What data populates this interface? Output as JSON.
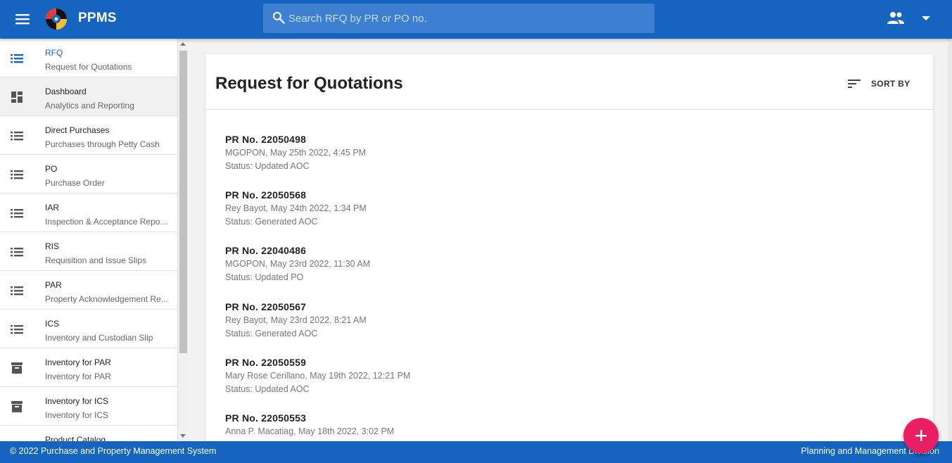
{
  "app": {
    "title": "PPMS"
  },
  "search": {
    "placeholder": "Search RFQ by PR or PO no."
  },
  "sidebar": {
    "items": [
      {
        "title": "RFQ",
        "subtitle": "Request for Quotations",
        "icon": "list-icon"
      },
      {
        "title": "Dashboard",
        "subtitle": "Analytics and Reporting",
        "icon": "dashboard-icon"
      },
      {
        "title": "Direct Purchases",
        "subtitle": "Purchases through Petty Cash",
        "icon": "list-icon"
      },
      {
        "title": "PO",
        "subtitle": "Purchase Order",
        "icon": "list-icon"
      },
      {
        "title": "IAR",
        "subtitle": "Inspection & Acceptance Repor...",
        "icon": "list-icon"
      },
      {
        "title": "RIS",
        "subtitle": "Requisition and Issue Slips",
        "icon": "list-icon"
      },
      {
        "title": "PAR",
        "subtitle": "Property Acknowledgement Re...",
        "icon": "list-icon"
      },
      {
        "title": "ICS",
        "subtitle": "Inventory and Custodian Slip",
        "icon": "list-icon"
      },
      {
        "title": "Inventory for PAR",
        "subtitle": "Inventory for PAR",
        "icon": "archive-icon"
      },
      {
        "title": "Inventory for ICS",
        "subtitle": "Inventory for ICS",
        "icon": "archive-icon"
      },
      {
        "title": "Product Catalog",
        "subtitle": "",
        "icon": "list-icon"
      }
    ]
  },
  "main": {
    "title": "Request for Quotations",
    "sort_label": "SORT BY",
    "rfqs": [
      {
        "pr": "PR No. 22050498",
        "meta": "MGOPON, May 25th 2022, 4:45 PM",
        "status": "Status: Updated AOC"
      },
      {
        "pr": "PR No. 22050568",
        "meta": "Rey Bayot, May 24th 2022, 1:34 PM",
        "status": "Status: Generated AOC"
      },
      {
        "pr": "PR No. 22040486",
        "meta": "MGOPON, May 23rd 2022, 11:30 AM",
        "status": "Status: Updated PO"
      },
      {
        "pr": "PR No. 22050567",
        "meta": "Rey Bayot, May 23rd 2022, 8:21 AM",
        "status": "Status: Generated AOC"
      },
      {
        "pr": "PR No. 22050559",
        "meta": "Mary Rose Cerillano, May 19th 2022, 12:21 PM",
        "status": "Status: Updated AOC"
      },
      {
        "pr": "PR No. 22050553",
        "meta": "Anna P. Macatiag, May 18th 2022, 3:02 PM",
        "status": ""
      }
    ]
  },
  "footer": {
    "left": "© 2022 Purchase and Property Management System",
    "right": "Planning and Management Division"
  },
  "colors": {
    "primary": "#1565c0",
    "accent": "#e91e63"
  }
}
